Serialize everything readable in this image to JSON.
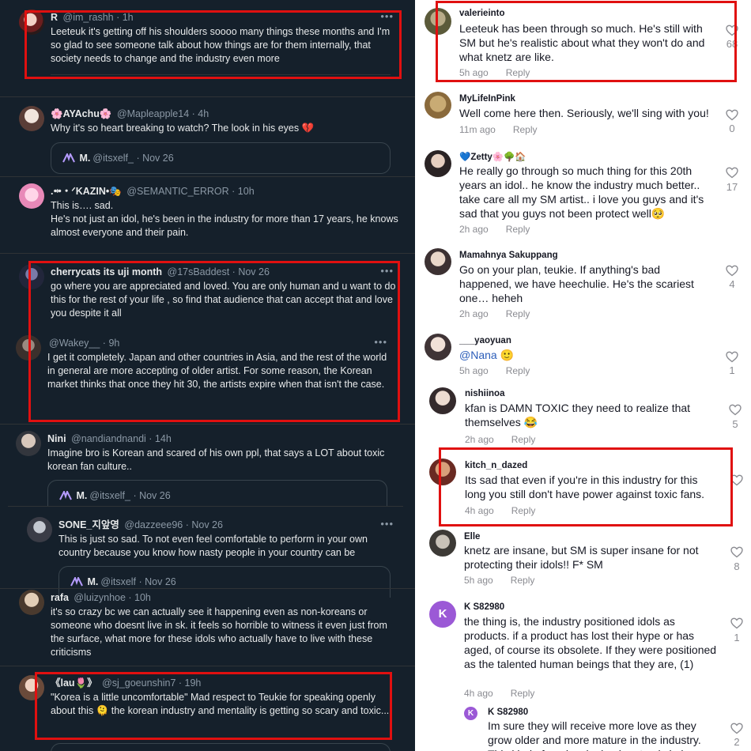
{
  "colors": {
    "highlight": "#e01010",
    "dark_bg": "#15202b",
    "handle": "#8b98a5",
    "mention": "#2b5db9"
  },
  "twitter": {
    "tweets": [
      {
        "name": "R",
        "handle": "@im_rashh · 1h",
        "text": "Leeteuk it's getting off his shoulders soooo many things these months and I'm so glad to see someone talk about how things are for them internally, that society needs to change and the industry even more"
      },
      {
        "name": "🌸AYAchu🌸",
        "handle": "@Mapleapple14 · 4h",
        "text": "Why it's so heart breaking to watch? The look in his eyes 💔",
        "quote": {
          "name": "M.",
          "handle": "@itsxelf_ · Nov 26"
        }
      },
      {
        "name": ".ꖒ・ᐟKAZIN•🎭",
        "handle": "@SEMANTIC_ERROR · 10h",
        "text": "This is…. sad.",
        "text2": "He's not just an idol, he's been in the industry for more than 17 years, he knows almost everyone and their pain."
      },
      {
        "name": "cherrycats its uji month",
        "handle": "@17sBaddest · Nov 26",
        "text": "go where you are appreciated and loved. You are only human and u want to do this for the rest of your life , so find that audience that can accept that and love you despite it all"
      },
      {
        "name": "",
        "handle": "@Wakey__ · 9h",
        "text": "I get it completely. Japan and other countries in Asia, and the rest of the world in general are more accepting of older artist. For some reason, the Korean market thinks that once they hit 30, the artists expire when that isn't the case."
      },
      {
        "name": "Nini",
        "handle": "@nandiandnandi · 14h",
        "text": "Imagine bro is Korean and scared of his own ppl, that says a LOT about toxic korean fan culture..",
        "quote": {
          "name": "M.",
          "handle": "@itsxelf_ · Nov 26"
        }
      },
      {
        "name": "SONE_지앞영",
        "handle": "@dazzeee96 · Nov 26",
        "text": "This is just so sad. To not even feel comfortable to perform in your own country because you know how nasty people in your country can be",
        "quote": {
          "name": "M.",
          "handle": "@itsxelf · Nov 26"
        }
      },
      {
        "name": "rafa",
        "handle": "@luizynhoe · 10h",
        "text": "it's so crazy bc we can actually see it happening even as non-koreans or someone who doesnt live in sk. it feels so horrible to witness it even just from the surface, what more for these idols who actually have to live with these criticisms"
      },
      {
        "name": "《lau🌷》",
        "handle": "@sj_goeunshin7 · 19h",
        "text": "\"Korea is a little uncomfortable\" Mad respect to Teukie for speaking openly about this 🫠 the korean industry and mentality is getting so scary and toxic..."
      }
    ]
  },
  "tiktok": {
    "reply_label": "Reply",
    "comments": [
      {
        "user": "valerieinto",
        "text": "Leeteuk has been through so much. He's still with SM but he's realistic about what they won't do and what knetz are like.",
        "time": "5h ago",
        "likes": "68"
      },
      {
        "user": "MyLifeInPink",
        "text": "Well come here then. Seriously, we'll sing with you!",
        "time": "11m ago",
        "likes": "0"
      },
      {
        "user": "💙Zetty🌸🌳🏠",
        "text": "He really go through so much thing for this 20th years an idol.. he know the industry much better.. take care all my SM artist.. i love you guys and it's sad that you guys not been protect well🥺",
        "time": "2h ago",
        "likes": "17"
      },
      {
        "user": "Mamahnya Sakuppang",
        "text": "Go on your plan, teukie. If anything's bad happened, we have heechulie. He's the scariest one… heheh",
        "time": "2h ago",
        "likes": "4"
      },
      {
        "user": "___yaoyuan",
        "mention": "@Nana",
        "emoji": "🙂",
        "time": "5h ago",
        "likes": "1"
      },
      {
        "user": "nishiinoa",
        "text": "kfan is DAMN TOXIC they need to realize that themselves 😂",
        "time": "2h ago",
        "likes": "5"
      },
      {
        "user": "kitch_n_dazed",
        "text": "Its sad that even if you're in this industry for this long you still don't have power against toxic fans.",
        "time": "4h ago",
        "likes": ""
      },
      {
        "user": "Elle",
        "text": "knetz are insane, but SM is super insane for not protecting their idols!! F* SM",
        "time": "5h ago",
        "likes": "8"
      },
      {
        "user": "K S82980",
        "avatar_letter": "K",
        "text": "the thing is, the industry positioned idols as products. if a product has lost their hype or has aged, of course its obsolete. If they were positioned as the talented human beings that they are, (1)",
        "time": "4h ago",
        "likes": "1"
      },
      {
        "user": "K S82980",
        "avatar_letter": "K",
        "text": "Im sure they will receive more love as they grow older and more mature in the industry. This kind of ageism is dominant only in k-pop",
        "time": "",
        "likes": "2"
      }
    ]
  }
}
